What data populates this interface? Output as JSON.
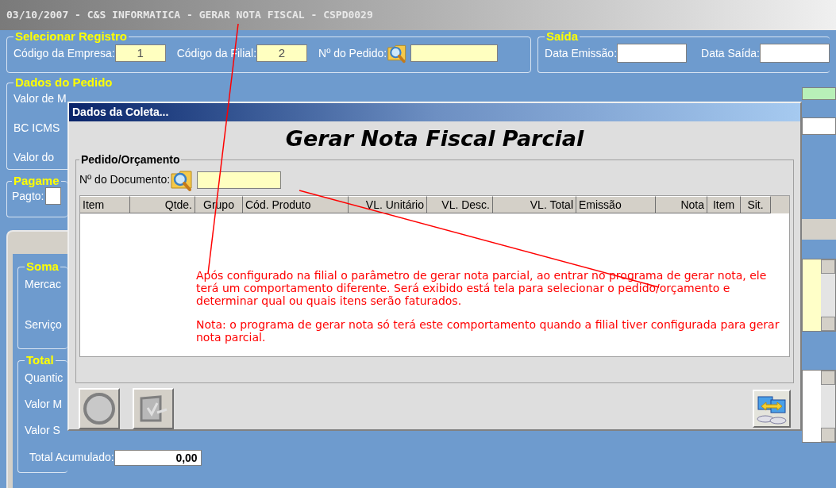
{
  "window": {
    "title": "03/10/2007 - C&S INFORMATICA - GERAR NOTA FISCAL - CSPD0029"
  },
  "selecionar_registro": {
    "title": "Selecionar Registro",
    "fields": [
      {
        "kind": "text",
        "label": "Código da Empresa:",
        "value": "1"
      },
      {
        "kind": "text",
        "label": "Código da Filial:",
        "value": "2"
      },
      {
        "kind": "lookup",
        "label": "Nº do Pedido:"
      }
    ]
  },
  "saida": {
    "title": "Saída",
    "fields": [
      {
        "label": "Data Emissão:"
      },
      {
        "label": "Data Saída:"
      }
    ]
  },
  "dados_do_pedido": {
    "title": "Dados do Pedido",
    "labels": [
      "Valor de M",
      "BC ICMS",
      "Valor do"
    ]
  },
  "pagamento": {
    "title": "Pagame",
    "label": "Pagto:"
  },
  "soma": {
    "title": "Soma",
    "labels": [
      "Mercac",
      "Serviço"
    ]
  },
  "total": {
    "title": "Total",
    "labels": [
      "Quantic",
      "Valor M",
      "Valor S"
    ],
    "accumulated": {
      "label": "Total Acumulado:",
      "value": "0,00"
    }
  },
  "dialog": {
    "title": "Dados da Coleta...",
    "heading": "Gerar Nota Fiscal Parcial",
    "group": {
      "title": "Pedido/Orçamento",
      "document_label": "Nº do Documento:"
    },
    "columns": [
      "Item",
      "Qtde.",
      "Grupo",
      "Cód. Produto",
      "VL. Unitário",
      "VL. Desc.",
      "VL. Total",
      "Emissão",
      "Nota",
      "Item",
      "Sit."
    ],
    "annotation": [
      "Após configurado na filial o parâmetro de gerar nota parcial, ao entrar no programa de gerar nota, ele terá um comportamento diferente. Será exibido está tela para selecionar o pedido/orçamento e determinar qual ou quais itens serão faturados.",
      "Nota: o programa de gerar nota só terá este comportamento quando a filial tiver configurada para gerar nota parcial."
    ]
  }
}
